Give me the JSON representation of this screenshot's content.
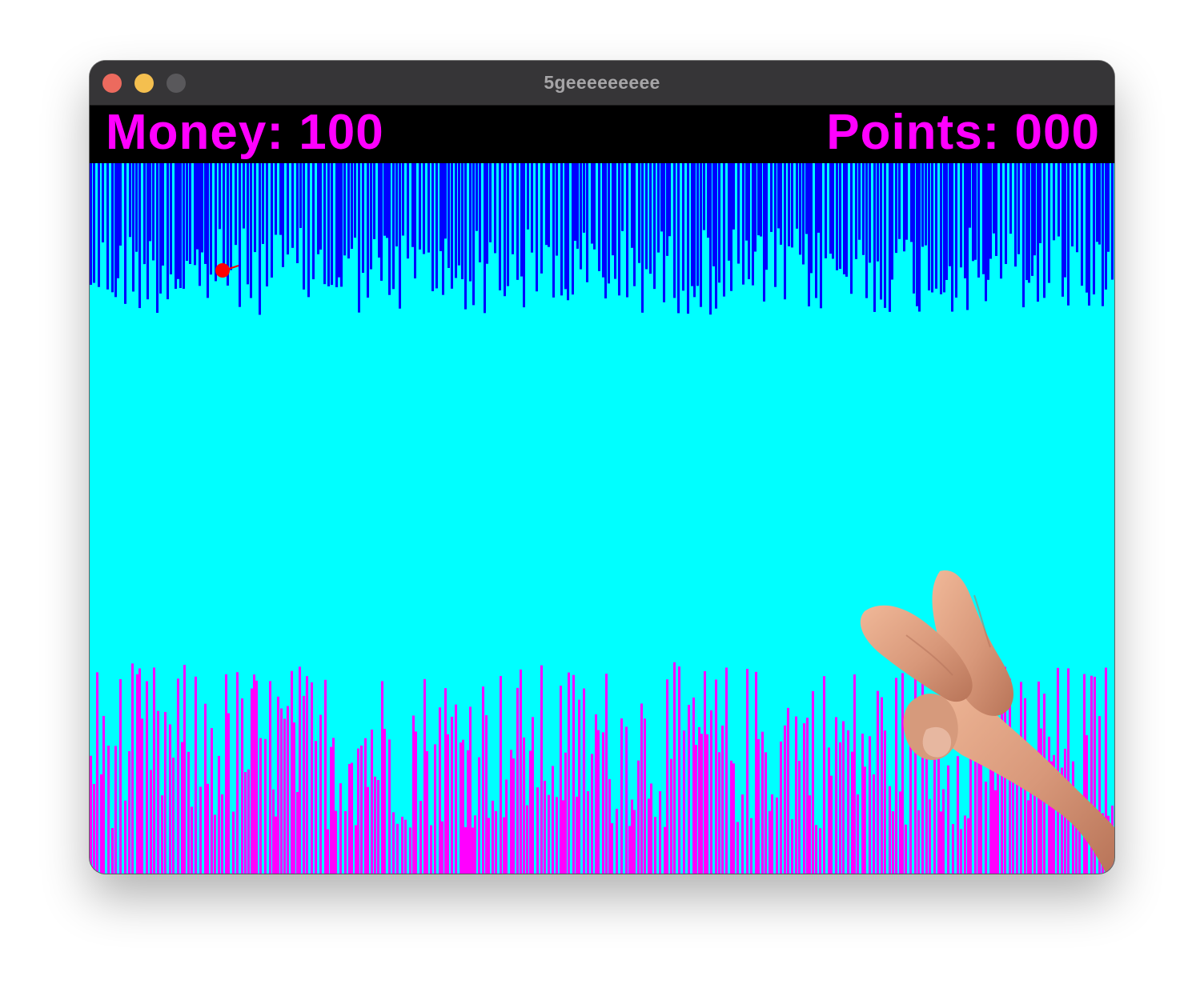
{
  "window": {
    "title": "5geeeeeeeee"
  },
  "hud": {
    "money_label": "Money: 100",
    "points_label": "Points: 000"
  },
  "colors": {
    "background": "#00ffff",
    "ceiling": "#0000ff",
    "floor": "#ff00ff",
    "hud_text": "#ff00ff",
    "hud_background": "#000000",
    "player": "#ff0000"
  },
  "icons": {
    "player": "red-dot-icon",
    "hand": "hand-icon"
  }
}
